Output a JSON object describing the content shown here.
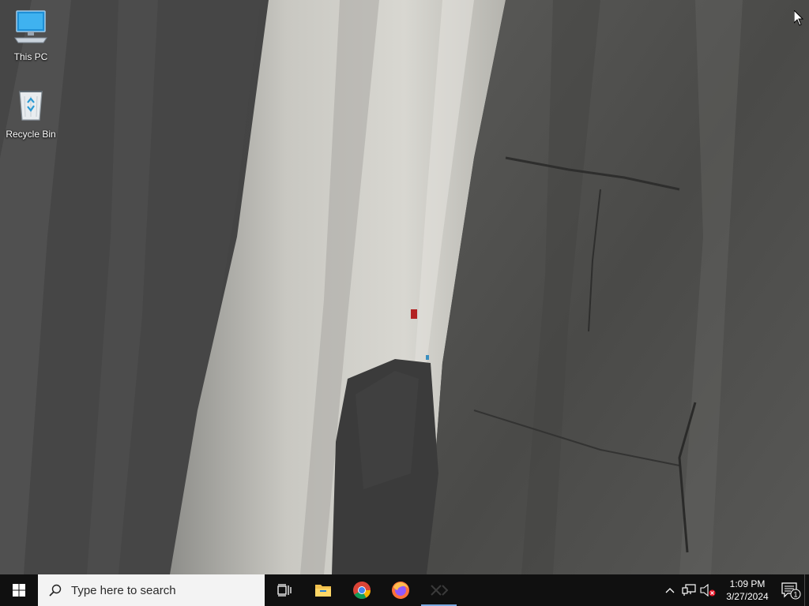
{
  "desktop": {
    "icons": [
      {
        "label": "This PC",
        "icon": "this-pc-icon"
      },
      {
        "label": "Recycle Bin",
        "icon": "recycle-bin-icon"
      }
    ]
  },
  "taskbar": {
    "search_placeholder": "Type here to search",
    "pinned": [
      {
        "name": "Task View",
        "icon": "task-view-icon"
      },
      {
        "name": "File Explorer",
        "icon": "file-explorer-icon"
      },
      {
        "name": "Google Chrome",
        "icon": "chrome-icon"
      },
      {
        "name": "Firefox",
        "icon": "firefox-icon"
      },
      {
        "name": "Running app",
        "icon": "app-icon",
        "active": true
      }
    ],
    "tray": {
      "time": "1:09 PM",
      "date": "3/27/2024",
      "notification_count": "1"
    }
  },
  "colors": {
    "taskbar_bg": "#101010",
    "search_bg": "#f3f3f3",
    "active_indicator": "#7aa9e0"
  }
}
